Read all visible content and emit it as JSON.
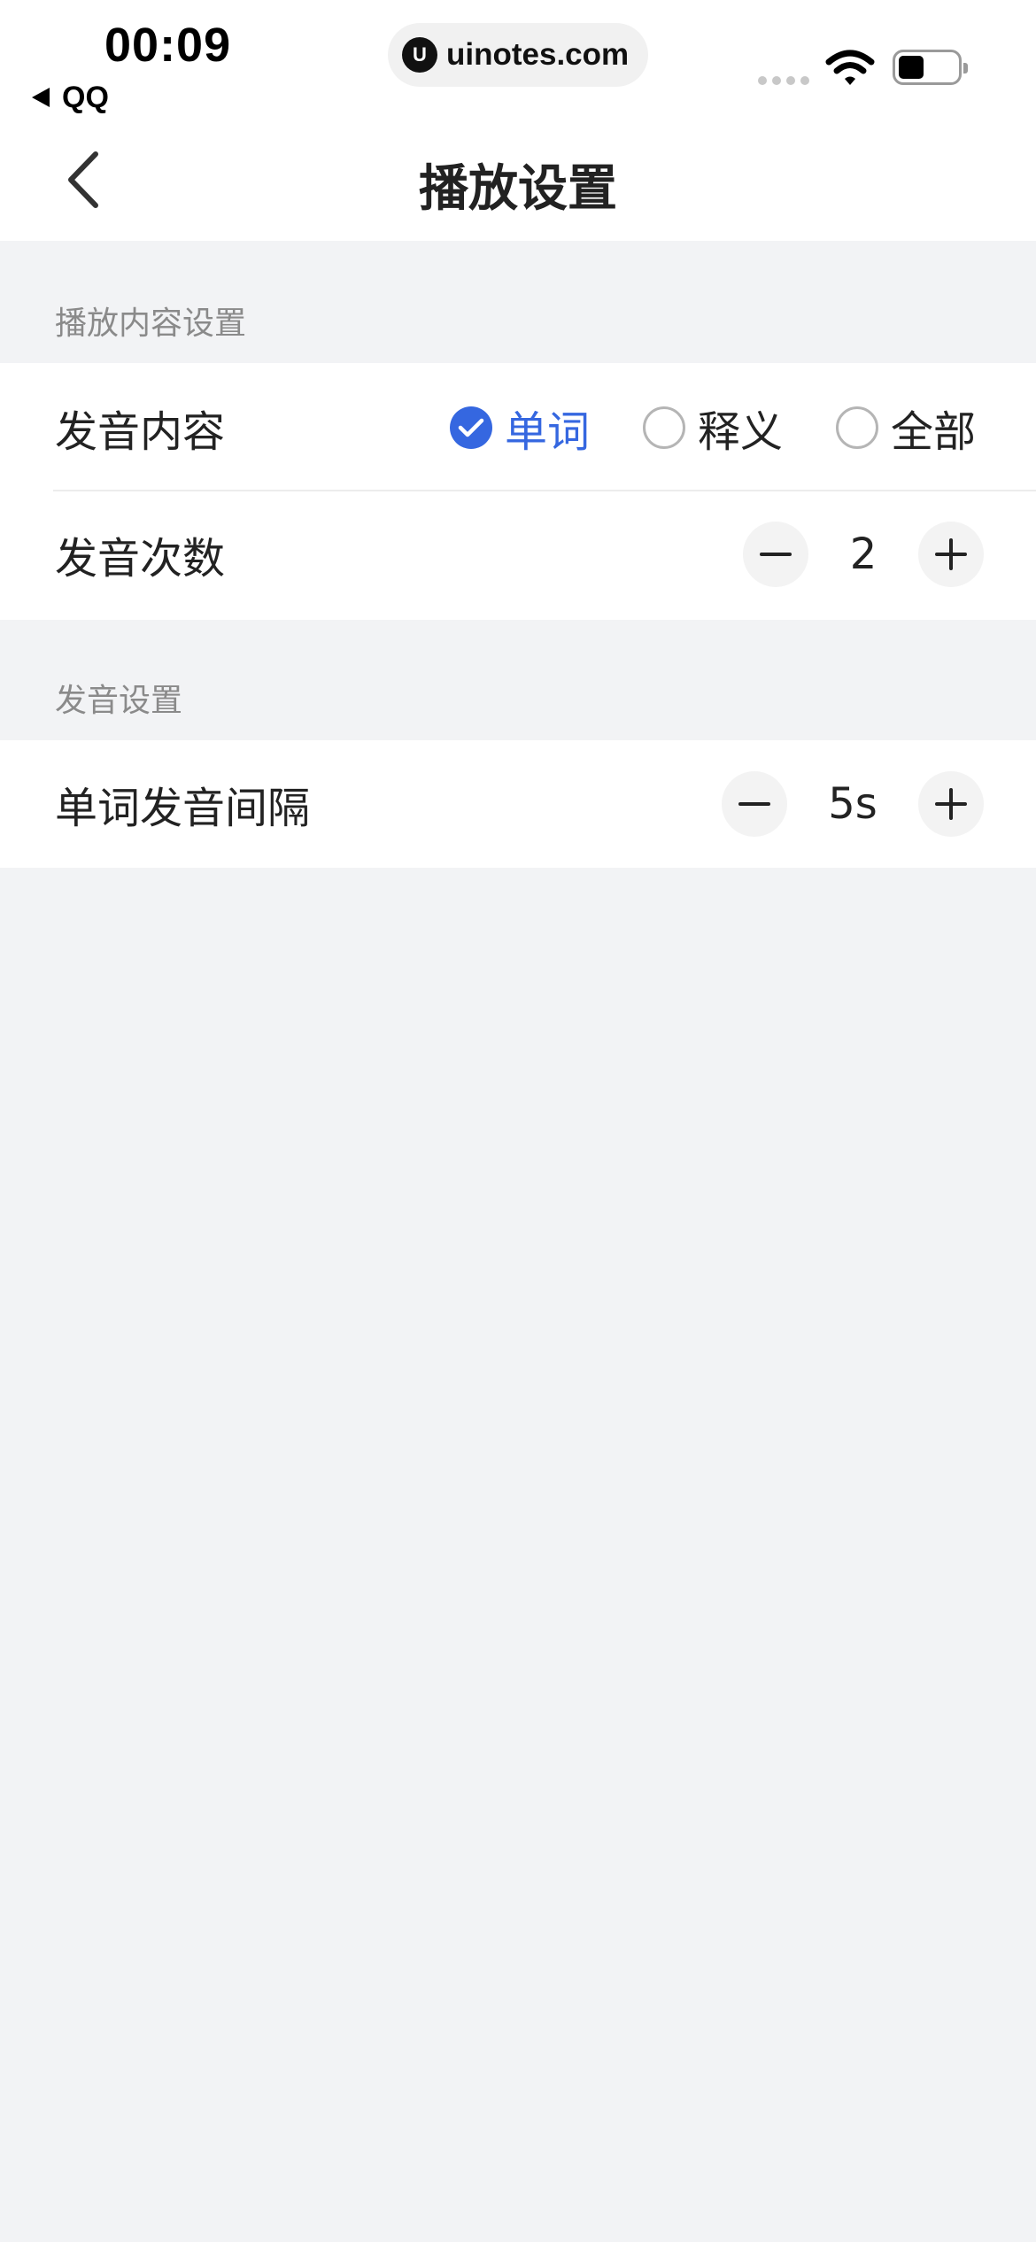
{
  "status_bar": {
    "time": "00:09",
    "back_app": "QQ",
    "url": "uinotes.com",
    "url_logo": "U"
  },
  "nav": {
    "title": "播放设置",
    "back_icon": "chevron-left-icon"
  },
  "sections": [
    {
      "label": "播放内容设置",
      "rows": [
        {
          "label": "发音内容",
          "options": [
            {
              "label": "单词",
              "checked": true
            },
            {
              "label": "释义",
              "checked": false
            },
            {
              "label": "全部",
              "checked": false
            }
          ]
        },
        {
          "label": "发音次数",
          "value": "2"
        }
      ]
    },
    {
      "label": "发音设置",
      "rows": [
        {
          "label": "单词发音间隔",
          "value": "5s"
        }
      ]
    }
  ],
  "colors": {
    "accent": "#3567e0",
    "background": "#f2f3f5",
    "card": "#ffffff"
  }
}
